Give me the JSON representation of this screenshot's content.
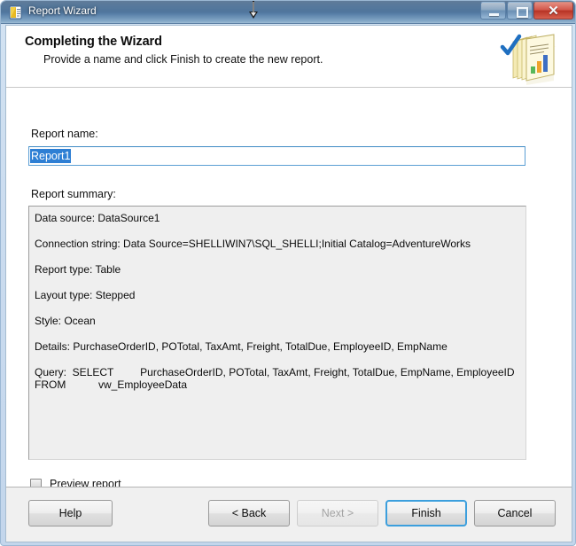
{
  "window": {
    "title": "Report Wizard",
    "icon": "report-wizard-icon",
    "controls": {
      "minimize": "minimize-icon",
      "maximize": "maximize-icon",
      "close": "✕"
    }
  },
  "header": {
    "title": "Completing the Wizard",
    "subtitle": "Provide a name and click Finish to create the new report.",
    "art_icon": "report-stack-with-checkmark-icon"
  },
  "form": {
    "name_label": "Report name:",
    "name_value": "Report1",
    "name_placeholder": "",
    "summary_label": "Report summary:",
    "summary_lines": [
      "Data source: DataSource1",
      "Connection string: Data Source=SHELLIWIN7\\SQL_SHELLI;Initial Catalog=AdventureWorks",
      "Report type: Table",
      "Layout type: Stepped",
      "Style: Ocean",
      "Details: PurchaseOrderID, POTotal, TaxAmt, Freight, TotalDue, EmployeeID, EmpName"
    ],
    "summary_query": "Query:  SELECT         PurchaseOrderID, POTotal, TaxAmt, Freight, TotalDue, EmpName, EmployeeID\nFROM           vw_EmployeeData",
    "preview_label": "Preview report",
    "preview_checked": false
  },
  "footer": {
    "help": "Help",
    "back": "< Back",
    "next": "Next >",
    "finish": "Finish",
    "cancel": "Cancel"
  },
  "colors": {
    "accent_focus": "#3c9fdd",
    "selection": "#2e7fd4",
    "titlebar": "#4a7199",
    "close_button": "#b83325"
  }
}
